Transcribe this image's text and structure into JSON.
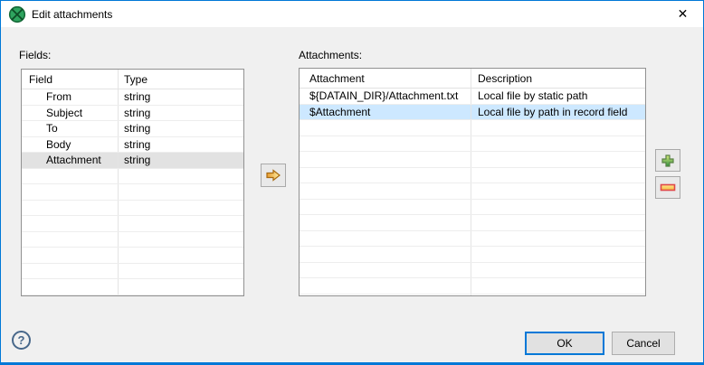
{
  "window": {
    "title": "Edit attachments",
    "close_glyph": "✕"
  },
  "fields_panel": {
    "label": "Fields:",
    "columns": [
      "Field",
      "Type"
    ],
    "rows": [
      {
        "field": "From",
        "type": "string"
      },
      {
        "field": "Subject",
        "type": "string"
      },
      {
        "field": "To",
        "type": "string"
      },
      {
        "field": "Body",
        "type": "string"
      },
      {
        "field": "Attachment",
        "type": "string"
      }
    ],
    "selected_index": 4,
    "empty_row_count": 9
  },
  "attachments_panel": {
    "label": "Attachments:",
    "columns": [
      "Attachment",
      "Description"
    ],
    "rows": [
      {
        "attachment": "${DATAIN_DIR}/Attachment.txt",
        "description": "Local file by static path"
      },
      {
        "attachment": "$Attachment",
        "description": "Local file by path in record field"
      }
    ],
    "selected_index": 1,
    "empty_row_count": 12
  },
  "actions": {
    "ok_label": "OK",
    "cancel_label": "Cancel",
    "help_glyph": "?"
  },
  "icons": {
    "app": "clover-logo-icon",
    "move_right": "arrow-right-icon",
    "add": "plus-icon",
    "remove": "minus-icon",
    "help": "question-mark-icon",
    "close": "close-icon"
  },
  "colors": {
    "accent": "#0078d7",
    "selection_active": "#cde8ff",
    "selection_inactive": "#e2e2e2"
  }
}
